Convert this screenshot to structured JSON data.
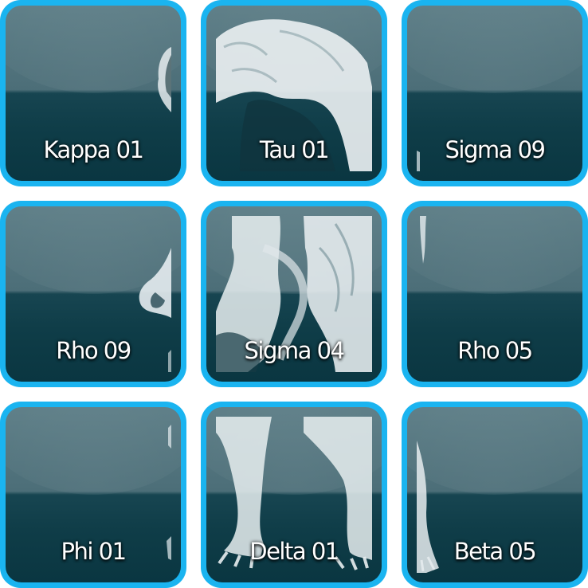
{
  "tiles": [
    {
      "label": "Kappa 01",
      "art": "fur-edge-head-icon"
    },
    {
      "label": "Tau 01",
      "art": "beast-head-fur-icon"
    },
    {
      "label": "Sigma 09",
      "art": "empty-icon"
    },
    {
      "label": "Rho 09",
      "art": "claw-edge-icon"
    },
    {
      "label": "Sigma 04",
      "art": "beast-torso-fur-icon"
    },
    {
      "label": "Rho 05",
      "art": "fur-sliver-icon"
    },
    {
      "label": "Phi 01",
      "art": "fur-edge-small-icon"
    },
    {
      "label": "Delta 01",
      "art": "beast-legs-paws-icon"
    },
    {
      "label": "Beta 05",
      "art": "leg-edge-icon"
    }
  ],
  "colors": {
    "tile_border": "#1ab4f0",
    "tile_top": "#5c7d86",
    "tile_bottom": "#0a3641",
    "label": "#ffffff"
  }
}
